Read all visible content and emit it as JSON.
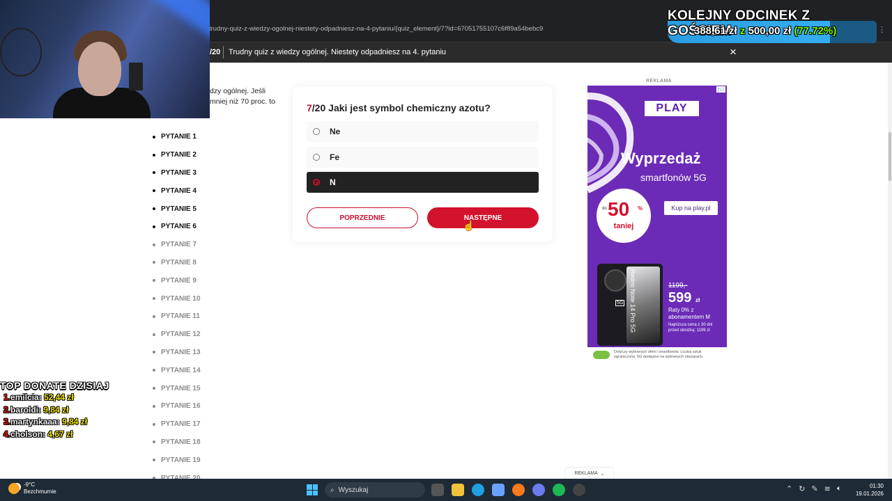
{
  "browser": {
    "url": "trudny-quiz-z-wiedzy-ogolnej-niestety-odpadniesz-na-4-pytaniu/{quiz_element}/7?id=67051755107c6f89a54bebc9"
  },
  "quiz_header": {
    "count": "/20",
    "title": "Trudny quiz z wiedzy ogólnej. Niestety odpadniesz na 4. pytaniu",
    "close_icon": "×"
  },
  "description": {
    "line1": "dzy ogólnej. Jeśli",
    "line2": " mniej niż 70 proc. to"
  },
  "question_list": [
    {
      "label": "PYTANIE 1",
      "state": "done"
    },
    {
      "label": "PYTANIE 2",
      "state": "done"
    },
    {
      "label": "PYTANIE 3",
      "state": "done"
    },
    {
      "label": "PYTANIE 4",
      "state": "done"
    },
    {
      "label": "PYTANIE 5",
      "state": "done"
    },
    {
      "label": "PYTANIE 6",
      "state": "done"
    },
    {
      "label": "PYTANIE 7",
      "state": "todo"
    },
    {
      "label": "PYTANIE 8",
      "state": "todo"
    },
    {
      "label": "PYTANIE 9",
      "state": "todo"
    },
    {
      "label": "PYTANIE 10",
      "state": "todo"
    },
    {
      "label": "PYTANIE 11",
      "state": "todo"
    },
    {
      "label": "PYTANIE 12",
      "state": "todo"
    },
    {
      "label": "PYTANIE 13",
      "state": "todo"
    },
    {
      "label": "PYTANIE 14",
      "state": "todo"
    },
    {
      "label": "PYTANIE 15",
      "state": "todo"
    },
    {
      "label": "PYTANIE 16",
      "state": "todo"
    },
    {
      "label": "PYTANIE 17",
      "state": "todo"
    },
    {
      "label": "PYTANIE 18",
      "state": "todo"
    },
    {
      "label": "PYTANIE 19",
      "state": "todo"
    },
    {
      "label": "PYTANIE 20",
      "state": "todo"
    }
  ],
  "question": {
    "number": "7",
    "total": "/20",
    "text": " Jaki jest symbol chemiczny azotu?",
    "options": [
      {
        "label": "Ne",
        "selected": false
      },
      {
        "label": "Fe",
        "selected": false
      },
      {
        "label": "N",
        "selected": true
      }
    ],
    "prev_label": "POPRZEDNIE",
    "next_label": "NASTĘPNE"
  },
  "ad": {
    "label": "REKLAMA",
    "brand": "PLAY",
    "headline": "Wyprzedaż",
    "subheadline": "smartfonów 5G",
    "discount_prefix": "do",
    "discount_value": "50",
    "discount_sign": "%",
    "discount_word": "taniej",
    "cta": "Kup na play.pl",
    "phone_model": "Redmi Note 14 Pro 5G",
    "phone_5g_badge": "5G",
    "old_price": "1199,-",
    "new_price": "599",
    "new_price_unit": "zł",
    "installments": "Raty 0% z abonamentem M",
    "lowest_price": "Najniższa cena z 30 dni przed obniżką: 1199 zł",
    "footnote": "Dotyczy wybranych ofert i smartfonów. Liczba sztuk ograniczona. 5G dostępne na wybranych obszarach.",
    "bottom_label": "REKLAMA"
  },
  "stream_goal": {
    "title": "KOLEJNY ODCINEK Z GOŚCIEM",
    "current": "388,61 zł",
    "connector": "z",
    "target": "500,00 zł",
    "percent": "(77.72%)",
    "progress_fraction": 0.7772
  },
  "top_donate": {
    "title": "TOP DONATE DZISIAJ",
    "entries": [
      {
        "rank": "1.",
        "name": "emilcia",
        "amount": "52,44 zł"
      },
      {
        "rank": "2.",
        "name": "baroldi",
        "amount": "9,84 zł"
      },
      {
        "rank": "3.",
        "name": "martynkaaa",
        "amount": "9,84 zł"
      },
      {
        "rank": "4.",
        "name": "cholson",
        "amount": "4,67 zł"
      }
    ]
  },
  "taskbar": {
    "temperature": "-9°C",
    "weather": "Bezchmurnie",
    "search_placeholder": "Wyszukaj",
    "time": "01:30",
    "date": "19.01.2026"
  },
  "colors": {
    "accent_red": "#d3122d",
    "play_purple": "#6b2bb6"
  }
}
